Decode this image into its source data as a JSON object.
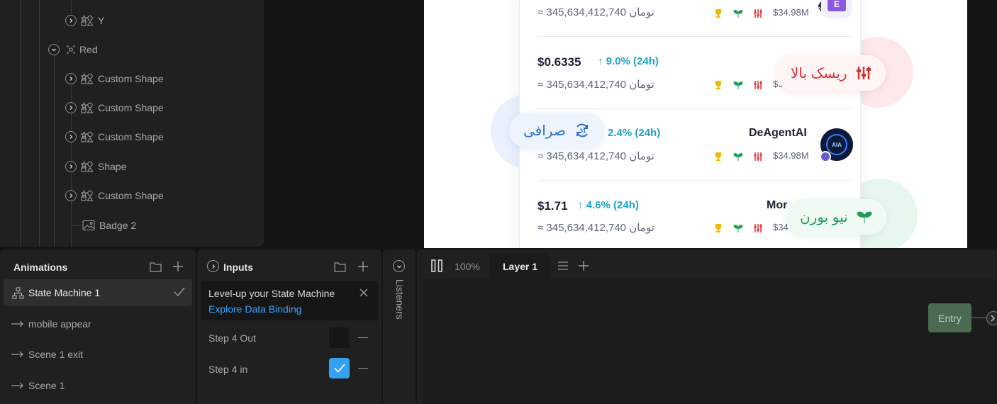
{
  "hierarchy": {
    "items": [
      {
        "label": "Y",
        "icon": "shapes-icon"
      },
      {
        "label": "Red",
        "icon": "group-icon"
      },
      {
        "label": "Custom Shape",
        "icon": "shapes-icon"
      },
      {
        "label": "Custom Shape",
        "icon": "shapes-icon"
      },
      {
        "label": "Custom Shape",
        "icon": "shapes-icon"
      },
      {
        "label": "Shape",
        "icon": "shapes-icon"
      },
      {
        "label": "Custom Shape",
        "icon": "shapes-icon"
      },
      {
        "label": "Badge 2",
        "icon": "image-icon"
      }
    ]
  },
  "artboard": {
    "rows": [
      {
        "toman": "≈ تومان 345,634,412,740",
        "mcap": "$34.98M"
      },
      {
        "price": "$0.6335",
        "change": "↑ 9.0% (24h)",
        "toman": "≈ تومان 345,634,412,740",
        "mcap": "$3"
      },
      {
        "change": "2.4% (24h)",
        "toman": "≈ تومان 345,634,412,740",
        "name": "DeAgentAI",
        "mcap": "$34.98M"
      },
      {
        "price": "$1.71",
        "change": "↑ 4.6% (24h)",
        "toman": "≈ تومان 345,634,412,740",
        "name": "Mor",
        "mcap": "$34"
      }
    ],
    "pills": {
      "risk": "ریسک بالا",
      "exchange": "صرافی",
      "newborn": "نیو بورن"
    },
    "colors": {
      "risk": "#e5383b",
      "exchange": "#2e6fd6",
      "newborn": "#1f9d55",
      "change": "#1fa3c4"
    }
  },
  "animations": {
    "title": "Animations",
    "state_machine": "State Machine 1",
    "items": [
      "mobile appear",
      "Scene 1 exit",
      "Scene 1"
    ]
  },
  "inputs": {
    "title": "Inputs",
    "promo_text": "Level-up your State Machine",
    "promo_link": "Explore Data Binding",
    "rows": [
      {
        "label": "Step 4 Out",
        "checked": false
      },
      {
        "label": "Step 4 in",
        "checked": true
      }
    ]
  },
  "listeners": {
    "title": "Listeners"
  },
  "graph": {
    "zoom": "100%",
    "layer_tab": "Layer 1",
    "entry_node": "Entry"
  }
}
